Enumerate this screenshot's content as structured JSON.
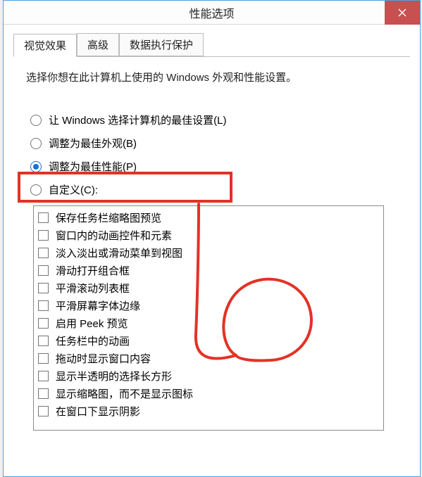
{
  "title": "性能选项",
  "tabs": [
    {
      "label": "视觉效果"
    },
    {
      "label": "高级"
    },
    {
      "label": "数据执行保护"
    }
  ],
  "intro": "选择你想在此计算机上使用的 Windows 外观和性能设置。",
  "radios": [
    {
      "label": "让 Windows 选择计算机的最佳设置(L)"
    },
    {
      "label": "调整为最佳外观(B)"
    },
    {
      "label": "调整为最佳性能(P)"
    },
    {
      "label": "自定义(C):"
    }
  ],
  "checks": [
    {
      "label": "保存任务栏缩略图预览"
    },
    {
      "label": "窗口内的动画控件和元素"
    },
    {
      "label": "淡入淡出或滑动菜单到视图"
    },
    {
      "label": "滑动打开组合框"
    },
    {
      "label": "平滑滚动列表框"
    },
    {
      "label": "平滑屏幕字体边缘"
    },
    {
      "label": "启用 Peek 预览"
    },
    {
      "label": "任务栏中的动画"
    },
    {
      "label": "拖动时显示窗口内容"
    },
    {
      "label": "显示半透明的选择长方形"
    },
    {
      "label": "显示缩略图，而不是显示图标"
    },
    {
      "label": "在窗口下显示阴影"
    }
  ]
}
